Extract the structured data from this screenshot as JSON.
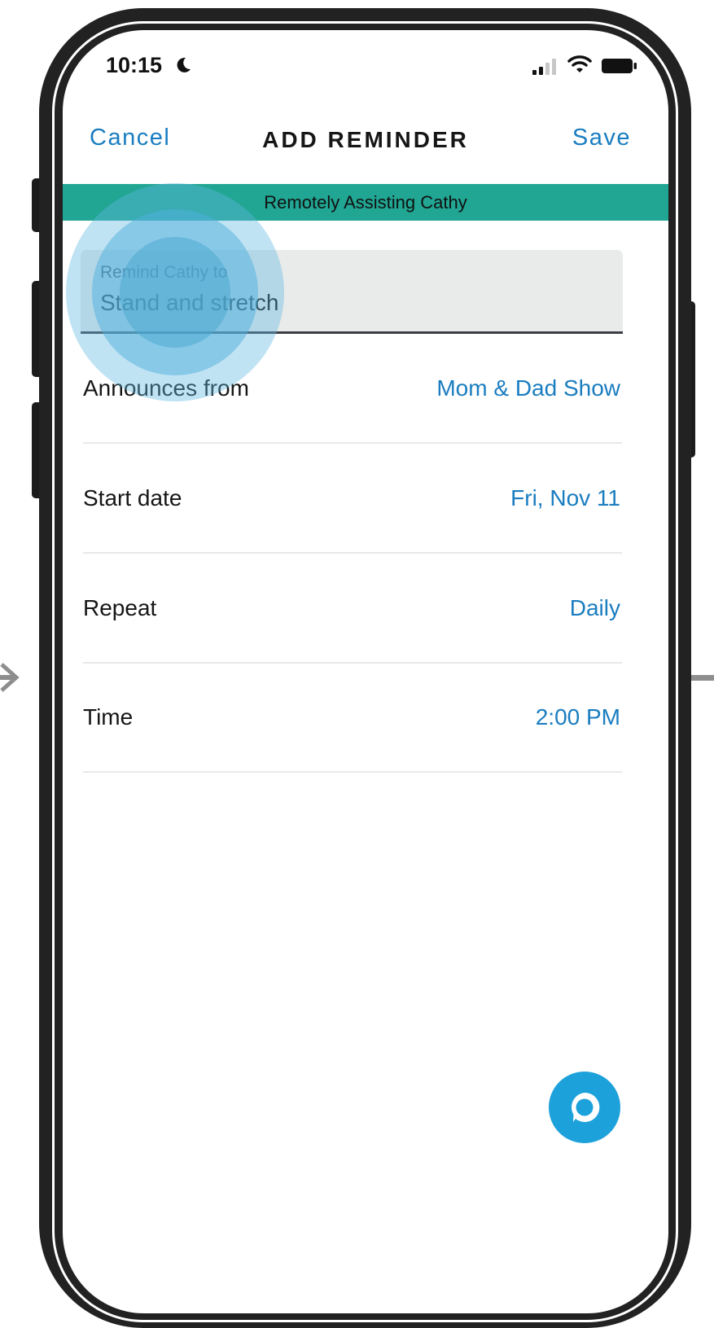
{
  "status_bar": {
    "time": "10:15",
    "icons": [
      "moon-icon",
      "signal-icon",
      "wifi-icon",
      "battery-icon"
    ]
  },
  "header": {
    "cancel_label": "Cancel",
    "title": "ADD REMINDER",
    "save_label": "Save"
  },
  "banner": {
    "text": "Remotely Assisting Cathy",
    "color": "#21a693"
  },
  "reminder_input": {
    "label": "Remind Cathy to",
    "value": "Stand and stretch"
  },
  "settings": [
    {
      "label": "Announces from",
      "value": "Mom & Dad Show"
    },
    {
      "label": "Start date",
      "value": "Fri, Nov 11"
    },
    {
      "label": "Repeat",
      "value": "Daily"
    },
    {
      "label": "Time",
      "value": "2:00 PM"
    }
  ],
  "fab": {
    "icon": "alexa-icon",
    "color": "#1da1db"
  },
  "colors": {
    "accent": "#1a7dc0"
  }
}
